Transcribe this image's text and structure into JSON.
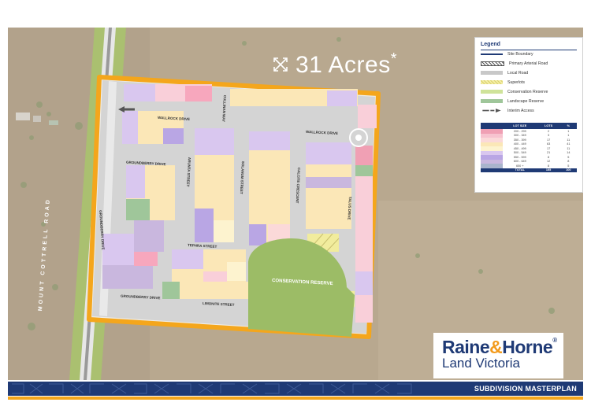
{
  "headline": {
    "value": "31 Acres",
    "mark": "*",
    "icon": "expand-arrows-icon"
  },
  "roads": {
    "mount_cottrell_road": "MOUNT COTTRELL ROAD",
    "wallrock_drive_a": "WALLROCK DRIVE",
    "wallrock_drive_b": "WALLROCK DRIVE",
    "groundberry_drive_a": "GROUNDBERRY DRIVE",
    "groundberry_drive_b": "GROUNDBERRY DRIVE",
    "groundberry_drive_c": "GROUNDBERRY DRIVE",
    "tephra_street": "TEPHRA STREET",
    "limonite_street": "LIMONITE STREET",
    "arunta_street": "ARUNTA STREET",
    "solanum_street": "SOLANUM STREET",
    "calcite_crescent": "CALCITE CRESCENT",
    "talus_drive": "TALUS DRIVE",
    "cullinan_way": "CULLINAN WAY"
  },
  "conservation_label": "CONSERVATION RESERVE",
  "legend": {
    "title": "Legend",
    "items": [
      {
        "label": "Site Boundary",
        "swatch": "line",
        "color": "#1f3a75"
      },
      {
        "label": "Primary Arterial Road",
        "swatch": "hatch",
        "color": "#555555"
      },
      {
        "label": "Local Road",
        "swatch": "solid",
        "color": "#c8c8c8"
      },
      {
        "label": "Superlots",
        "swatch": "stripe",
        "color": "#e8e28a"
      },
      {
        "label": "Conservation Reserve",
        "swatch": "solid",
        "color": "#cfe39a"
      },
      {
        "label": "Landscape Reserve",
        "swatch": "solid",
        "color": "#9fc69a"
      },
      {
        "label": "Interim Access",
        "swatch": "arrow",
        "color": "#555555"
      }
    ],
    "table": {
      "headers": [
        "LOT SIZE",
        "LOTS",
        "%"
      ],
      "rows": [
        {
          "swatch": "#f0a0b4",
          "size": "200 - 299",
          "lots": "2",
          "pct": "1"
        },
        {
          "swatch": "#f7c3cf",
          "size": "300 - 349",
          "lots": "3",
          "pct": "1"
        },
        {
          "swatch": "#fbd9d9",
          "size": "350 - 399",
          "lots": "17",
          "pct": "11"
        },
        {
          "swatch": "#fbe7b7",
          "size": "400 - 449",
          "lots": "63",
          "pct": "41"
        },
        {
          "swatch": "#fdf3cf",
          "size": "450 - 499",
          "lots": "17",
          "pct": "11"
        },
        {
          "swatch": "#d9c7ef",
          "size": "500 - 549",
          "lots": "21",
          "pct": "14"
        },
        {
          "swatch": "#b9a6e4",
          "size": "550 - 599",
          "lots": "8",
          "pct": "5"
        },
        {
          "swatch": "#c9b7de",
          "size": "600 - 649",
          "lots": "12",
          "pct": "8"
        },
        {
          "swatch": "#a9b4cc",
          "size": "650 +",
          "lots": "8",
          "pct": "5"
        }
      ],
      "total": {
        "label": "TOTAL",
        "lots": "155",
        "pct": "100"
      }
    }
  },
  "brand": {
    "line1_a": "Raine",
    "line1_amp": "&",
    "line1_b": "Horne",
    "line2": "Land Victoria",
    "reg": "®"
  },
  "footer_title": "SUBDIVISION MASTERPLAN",
  "colors": {
    "boundary": "#f4a61c",
    "navy": "#1f3a75",
    "conservation": "#9cbc66",
    "road": "#d3d3d3",
    "aerial": "#b6a68e"
  }
}
